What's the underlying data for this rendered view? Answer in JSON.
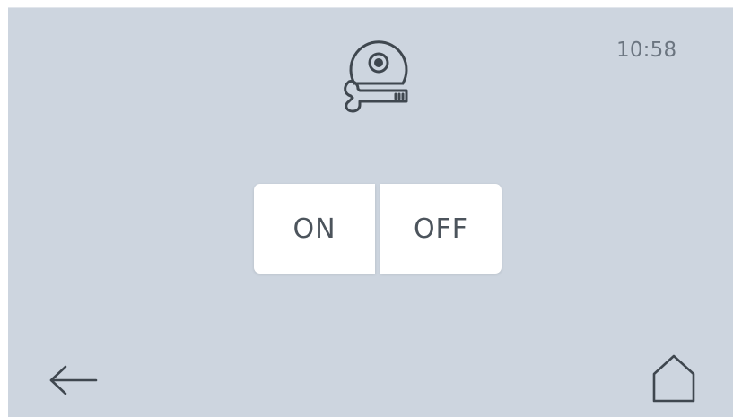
{
  "status": {
    "time": "10:58"
  },
  "header": {
    "icon": "disc-wrench-icon"
  },
  "toggle": {
    "on_label": "ON",
    "off_label": "OFF"
  },
  "footer": {
    "back_icon": "arrow-left-icon",
    "home_icon": "home-icon"
  },
  "colors": {
    "background": "#cdd5df",
    "button": "#ffffff",
    "text": "#4c545c",
    "icon": "#3f474f"
  }
}
